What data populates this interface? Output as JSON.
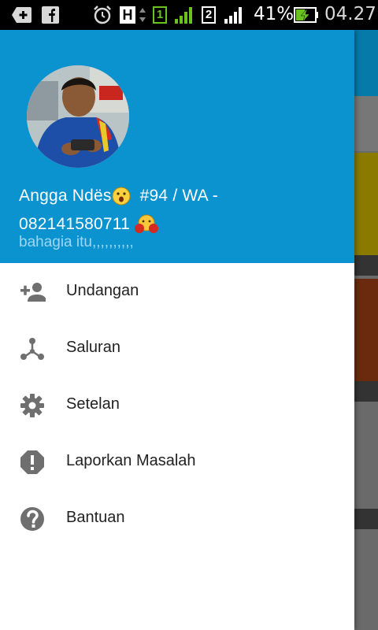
{
  "status_bar": {
    "sim1_label": "1",
    "sim2_label": "2",
    "network_type": "H",
    "battery_percent": "41%",
    "time": "04.27"
  },
  "drawer": {
    "header": {
      "user_name_line1": "Angga Ndës",
      "user_name_mid": "#94 / WA -",
      "user_name_line2": "082141580711",
      "status_text": "bahagia itu,,,,,,,,,,",
      "header_color": "#0a93cf"
    },
    "menu": [
      {
        "label": "Undangan",
        "icon": "add-person-icon"
      },
      {
        "label": "Saluran",
        "icon": "channels-icon"
      },
      {
        "label": "Setelan",
        "icon": "gear-icon"
      },
      {
        "label": "Laporkan Masalah",
        "icon": "alert-icon"
      },
      {
        "label": "Bantuan",
        "icon": "help-icon"
      }
    ]
  }
}
